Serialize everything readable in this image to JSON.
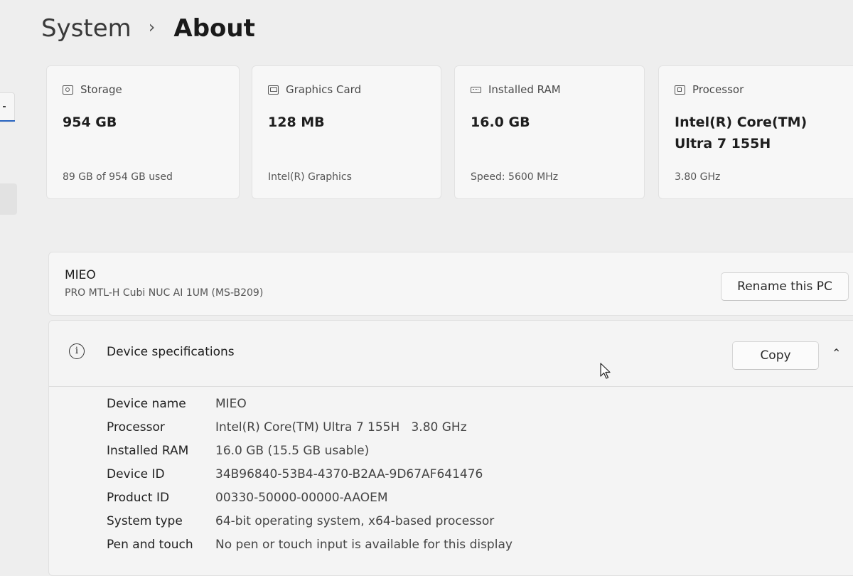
{
  "header": {
    "parent": "System",
    "separator": "›",
    "current": "About"
  },
  "cards": [
    {
      "icon": "storage-icon",
      "title": "Storage",
      "value": "954 GB",
      "sub": "89 GB of 954 GB used"
    },
    {
      "icon": "graphics-card-icon",
      "title": "Graphics Card",
      "value": "128 MB",
      "sub": "Intel(R) Graphics"
    },
    {
      "icon": "ram-icon",
      "title": "Installed RAM",
      "value": "16.0 GB",
      "sub": "Speed: 5600 MHz"
    },
    {
      "icon": "processor-icon",
      "title": "Processor",
      "value": "Intel(R) Core(TM) Ultra 7 155H",
      "sub": "3.80 GHz"
    }
  ],
  "pc": {
    "name": "MIEO",
    "model": "PRO MTL-H Cubi NUC AI 1UM (MS-B209)",
    "rename_label": "Rename this PC"
  },
  "specs": {
    "title": "Device specifications",
    "info_glyph": "i",
    "copy_label": "Copy",
    "collapse_glyph": "⌃",
    "rows": [
      {
        "label": "Device name",
        "value": "MIEO"
      },
      {
        "label": "Processor",
        "value": "Intel(R) Core(TM) Ultra 7 155H   3.80 GHz"
      },
      {
        "label": "Installed RAM",
        "value": "16.0 GB (15.5 GB usable)"
      },
      {
        "label": "Device ID",
        "value": "34B96840-53B4-4370-B2AA-9D67AF641476"
      },
      {
        "label": "Product ID",
        "value": "00330-50000-00000-AAOEM"
      },
      {
        "label": "System type",
        "value": "64-bit operating system, x64-based processor"
      },
      {
        "label": "Pen and touch",
        "value": "No pen or touch input is available for this display"
      }
    ]
  },
  "colors": {
    "background": "#eeeeee",
    "card": "#f7f7f7",
    "accent": "#2a66c2"
  }
}
